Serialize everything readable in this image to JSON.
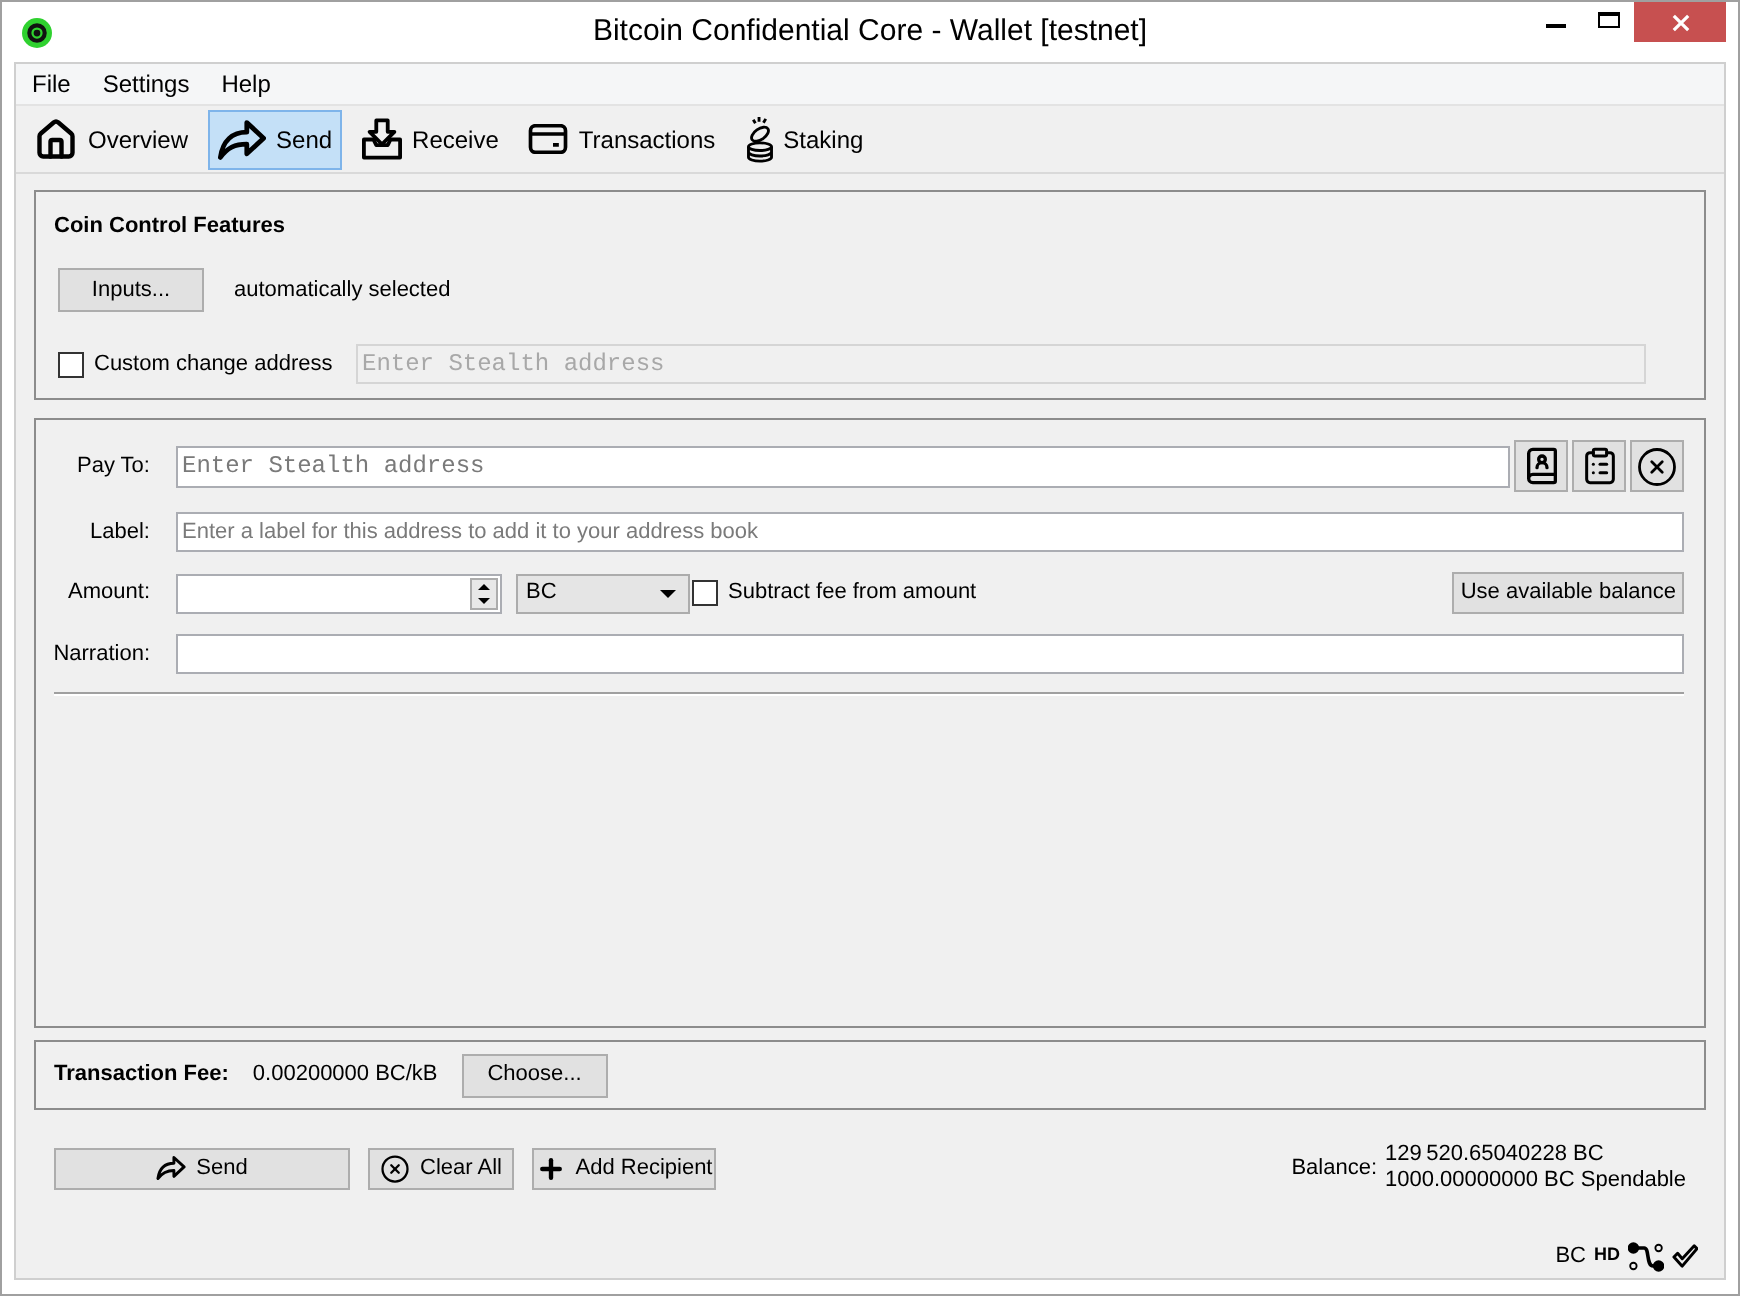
{
  "window": {
    "title": "Bitcoin Confidential Core - Wallet [testnet]"
  },
  "menu": [
    {
      "label": "File"
    },
    {
      "label": "Settings"
    },
    {
      "label": "Help"
    }
  ],
  "toolbar": [
    {
      "label": "Overview",
      "selected": false
    },
    {
      "label": "Send",
      "selected": true
    },
    {
      "label": "Receive",
      "selected": false
    },
    {
      "label": "Transactions",
      "selected": false
    },
    {
      "label": "Staking",
      "selected": false
    }
  ],
  "coin_control": {
    "title": "Coin Control Features",
    "inputs_button": "Inputs...",
    "inputs_status": "automatically selected",
    "custom_change": {
      "label": "Custom change address",
      "checked": false,
      "placeholder": "Enter Stealth address",
      "disabled": true
    }
  },
  "recipient": {
    "pay_to": {
      "label": "Pay To:",
      "placeholder": "Enter Stealth address"
    },
    "label": {
      "label": "Label:",
      "placeholder": "Enter a label for this address to add it to your address book"
    },
    "amount": {
      "label": "Amount:",
      "unit": "BC",
      "subtract_fee": {
        "label": "Subtract fee from amount",
        "checked": false
      },
      "use_balance_button": "Use available balance"
    },
    "narration": {
      "label": "Narration:"
    }
  },
  "transaction_fee": {
    "label": "Transaction Fee:",
    "value": "0.00200000 BC/kB",
    "button": "Choose..."
  },
  "actions": [
    {
      "label": "Send"
    },
    {
      "label": "Clear All"
    },
    {
      "label": "Add Recipient"
    }
  ],
  "balance": {
    "label": "Balance:",
    "total": "129 520.65040228 BC",
    "spendable": "1000.00000000 BC Spendable"
  },
  "status_bar": {
    "unit": "BC",
    "hd": "HD"
  }
}
